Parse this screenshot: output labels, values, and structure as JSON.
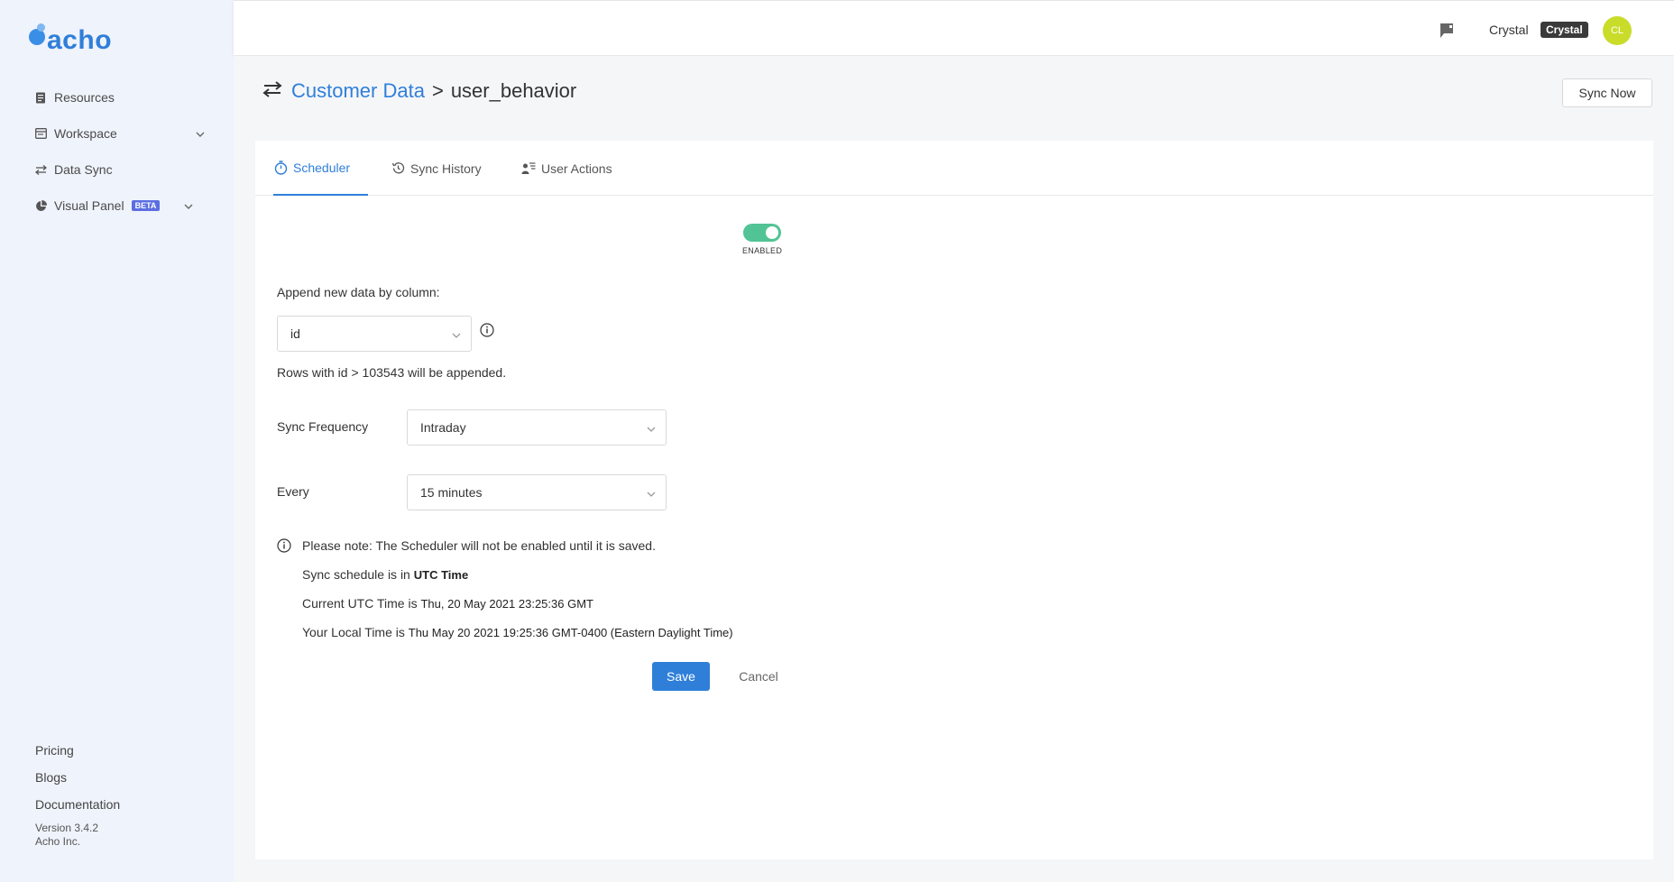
{
  "brand": {
    "logo_text": "acho",
    "accent": "#2f7fd9"
  },
  "sidebar": {
    "items": [
      {
        "label": "Resources",
        "icon": "resources-icon"
      },
      {
        "label": "Workspace",
        "icon": "workspace-icon",
        "expandable": true
      },
      {
        "label": "Data Sync",
        "icon": "data-sync-icon"
      },
      {
        "label": "Visual Panel",
        "icon": "visual-panel-icon",
        "badge": "BETA",
        "expandable": true
      }
    ],
    "footer_links": [
      "Pricing",
      "Blogs",
      "Documentation"
    ],
    "version": "Version 3.4.2",
    "company": "Acho Inc."
  },
  "topbar": {
    "user_name": "Crystal",
    "user_badge": "Crystal",
    "avatar_initials": "CL",
    "avatar_color": "#c9dc2a"
  },
  "header": {
    "breadcrumb_parent": "Customer Data",
    "breadcrumb_separator": ">",
    "breadcrumb_current": "user_behavior",
    "sync_now_label": "Sync Now"
  },
  "tabs": [
    {
      "label": "Scheduler",
      "active": true
    },
    {
      "label": "Sync History",
      "active": false
    },
    {
      "label": "User Actions",
      "active": false
    }
  ],
  "scheduler": {
    "toggle_label": "ENABLED",
    "toggle_on": true,
    "append_label": "Append new data by column:",
    "append_column": "id",
    "append_hint": "Rows with id > 103543 will be appended.",
    "frequency_label": "Sync Frequency",
    "frequency_value": "Intraday",
    "every_label": "Every",
    "every_value": "15 minutes",
    "note": "Please note: The Scheduler will not be enabled until it is saved.",
    "utc_prefix": "Sync schedule is in ",
    "utc_bold": "UTC Time",
    "current_utc_prefix": "Current UTC Time is ",
    "current_utc_value": "Thu, 20 May 2021 23:25:36 GMT",
    "local_prefix": "Your Local Time is ",
    "local_value": "Thu May 20 2021 19:25:36 GMT-0400 (Eastern Daylight Time)",
    "save_label": "Save",
    "cancel_label": "Cancel"
  }
}
